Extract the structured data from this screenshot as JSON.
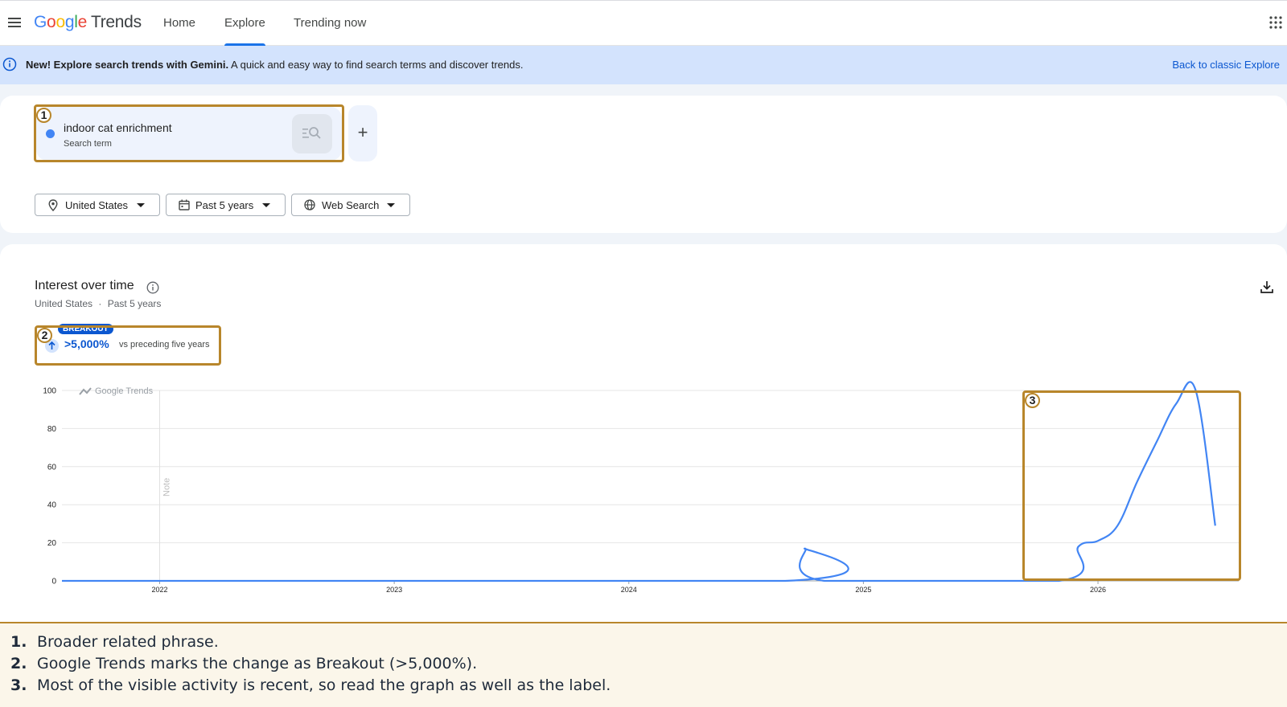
{
  "app": {
    "logo_google": "Google",
    "logo_trends": "Trends",
    "nav": [
      {
        "label": "Home"
      },
      {
        "label": "Explore",
        "active": true
      },
      {
        "label": "Trending now"
      }
    ]
  },
  "banner": {
    "bold_text": "New! Explore search trends with Gemini.",
    "text": " A quick and easy way to find search terms and discover trends.",
    "link": "Back to classic Explore"
  },
  "search_term": {
    "name": "indoor cat enrichment",
    "type": "Search term",
    "dot_color": "#4285f4"
  },
  "filters": {
    "location": "United States",
    "time": "Past 5 years",
    "property": "Web Search"
  },
  "interest_over_time": {
    "title": "Interest over time",
    "subtitle_location": "United States",
    "subtitle_separator": "·",
    "subtitle_time": "Past 5 years"
  },
  "breakout": {
    "badge": "BREAKOUT",
    "value": ">5,000%",
    "description": "vs preceding five years"
  },
  "chart_data": {
    "type": "line",
    "watermark": "Google Trends",
    "note_label": "Note",
    "ylim": [
      0,
      100
    ],
    "yticks": [
      "0",
      "20",
      "40",
      "60",
      "80",
      "100"
    ],
    "xticks": [
      "2022",
      "2023",
      "2024",
      "2025",
      "2026"
    ],
    "series": [
      {
        "color": "#4285f4",
        "points": [
          {
            "x": "2021-08",
            "y": 0
          },
          {
            "x": "2024-09",
            "y": 0
          },
          {
            "x": "2024-10",
            "y": 17
          },
          {
            "x": "2024-11",
            "y": 0
          },
          {
            "x": "2025-11",
            "y": 0
          },
          {
            "x": "2025-12",
            "y": 18
          },
          {
            "x": "2026-01",
            "y": 21
          },
          {
            "x": "2026-02",
            "y": 29
          },
          {
            "x": "2026-03",
            "y": 52
          },
          {
            "x": "2026-04",
            "y": 73
          },
          {
            "x": "2026-05",
            "y": 93
          },
          {
            "x": "2026-06",
            "y": 100
          },
          {
            "x": "2026-07",
            "y": 29
          }
        ]
      }
    ]
  },
  "annotations": [
    {
      "number": "1",
      "text": "Broader related phrase."
    },
    {
      "number": "2",
      "text": "Google Trends marks the change as Breakout (>5,000%)."
    },
    {
      "number": "3",
      "text": "Most of the visible activity is recent, so read the graph as well as the label."
    }
  ],
  "notes_prefix": [
    "1.",
    "2.",
    "3."
  ]
}
